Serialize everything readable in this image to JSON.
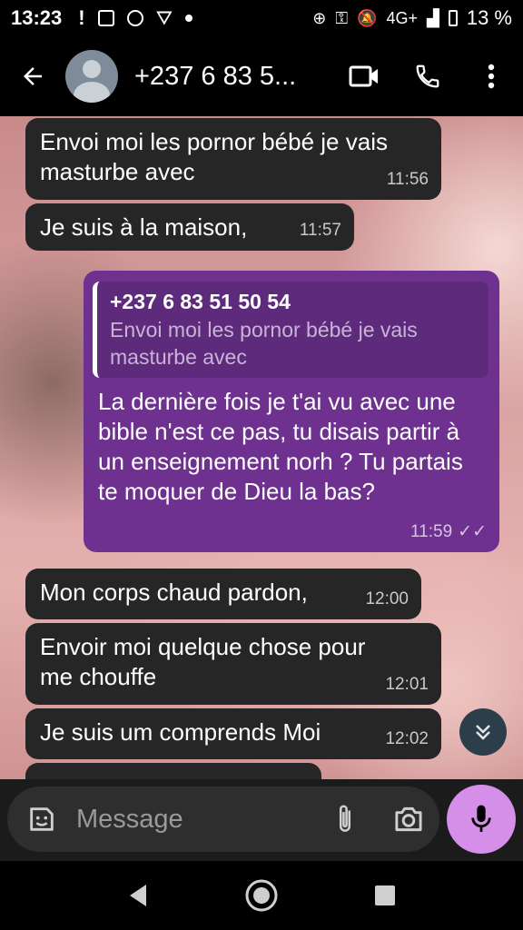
{
  "status_bar": {
    "time": "13:23",
    "network": "4G+",
    "battery": "13 %"
  },
  "header": {
    "contact": "+237 6 83 5...",
    "icons": [
      "back-arrow-icon",
      "avatar",
      "video-call-icon",
      "phone-icon",
      "more-vertical-icon"
    ]
  },
  "messages": [
    {
      "dir": "in",
      "text": "Envoi moi les pornor bébé je vais masturbe avec",
      "time": "11:56"
    },
    {
      "dir": "in",
      "text": "Je suis à la maison,",
      "time": "11:57"
    },
    {
      "dir": "out",
      "quote": {
        "author": "+237 6 83 51 50 54",
        "text": "Envoi moi les pornor bébé je vais masturbe avec"
      },
      "text": "La dernière fois je t'ai vu avec une bible n'est ce pas, tu disais partir à un enseignement norh ? Tu partais te moquer de Dieu la bas?",
      "time": "11:59"
    },
    {
      "dir": "in",
      "text": "Mon corps chaud pardon,",
      "time": "12:00"
    },
    {
      "dir": "in",
      "text": "Envoir moi quelque chose pour me chouffe",
      "time": "12:01"
    },
    {
      "dir": "in",
      "text": "Je suis um comprends Moi",
      "time": "12:02"
    }
  ],
  "composer": {
    "placeholder": "Message"
  },
  "colors": {
    "incoming_bubble": "#262626",
    "outgoing_bubble": "#6f3190",
    "mic_button": "#d58fe8"
  }
}
